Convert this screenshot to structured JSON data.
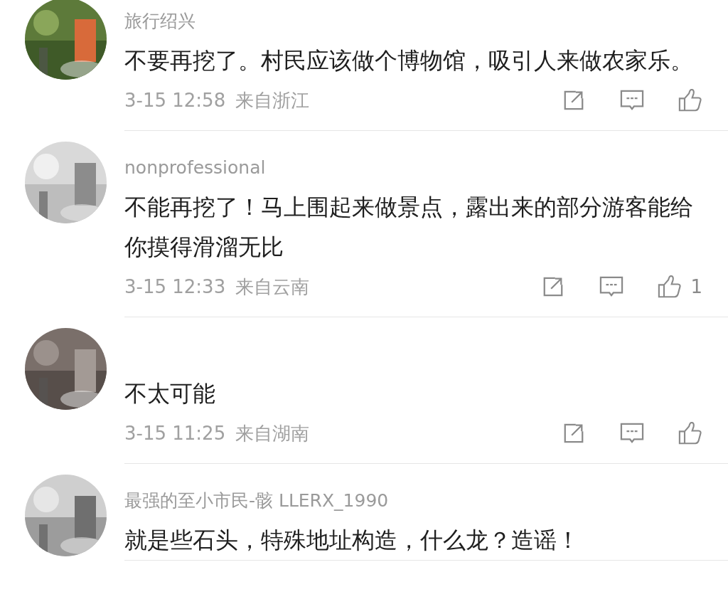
{
  "comments": [
    {
      "username": "旅行绍兴",
      "text": "不要再挖了。村民应该做个博物馆，吸引人来做农家乐。",
      "time": "3-15 12:58",
      "location": "来自浙江"
    },
    {
      "username": "nonprofessional",
      "text": "不能再挖了！马上围起来做景点，露出来的部分游客能给你摸得滑溜无比",
      "time": "3-15 12:33",
      "location": "来自云南",
      "likes": "1"
    },
    {
      "text": "不太可能",
      "time": "3-15 11:25",
      "location": "来自湖南"
    },
    {
      "username": "最强的至小市民-骸 LLERX_1990",
      "text": "就是些石头，特殊地址构造，什么龙？造谣！"
    }
  ]
}
